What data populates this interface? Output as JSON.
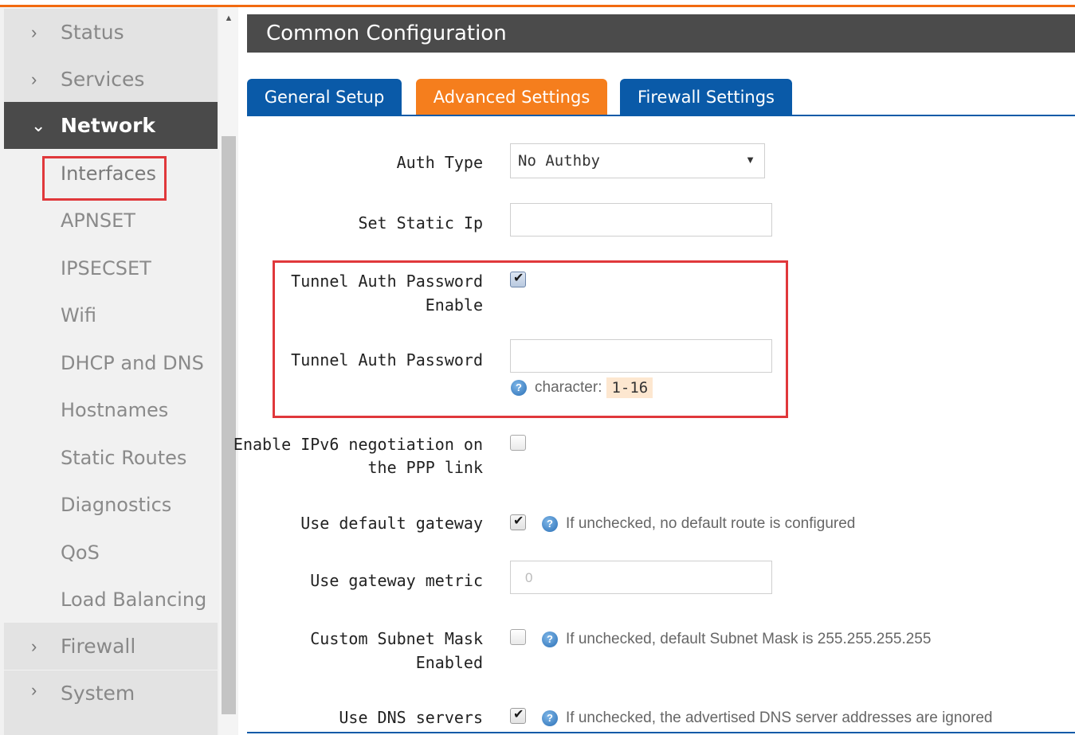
{
  "sidebar": {
    "groups_top": [
      {
        "label": "Status",
        "icon": "chevron-right-icon"
      },
      {
        "label": "Services",
        "icon": "chevron-right-icon"
      }
    ],
    "active_group": {
      "label": "Network",
      "icon": "chevron-down-icon"
    },
    "network_items": [
      "Interfaces",
      "APNSET",
      "IPSECSET",
      "Wifi",
      "DHCP and DNS",
      "Hostnames",
      "Static Routes",
      "Diagnostics",
      "QoS",
      "Load Balancing"
    ],
    "groups_bottom": [
      {
        "label": "Firewall",
        "icon": "chevron-right-icon"
      },
      {
        "label": "System",
        "icon": "chevron-right-icon"
      }
    ]
  },
  "header": {
    "title": "Common Configuration"
  },
  "tabs": [
    {
      "label": "General Setup",
      "active": false
    },
    {
      "label": "Advanced Settings",
      "active": true
    },
    {
      "label": "Firewall Settings",
      "active": false
    }
  ],
  "form": {
    "auth_type": {
      "label": "Auth Type",
      "value": "No Authby"
    },
    "static_ip": {
      "label": "Set Static Ip",
      "value": ""
    },
    "tunnel_pw_enable": {
      "label_line1": "Tunnel Auth Password",
      "label_line2": "Enable",
      "checked": true
    },
    "tunnel_pw": {
      "label": "Tunnel Auth Password",
      "value": "",
      "hint": "character:",
      "hint_range": "1-16"
    },
    "ipv6": {
      "label_line1": "Enable IPv6 negotiation on",
      "label_line2": "the PPP link",
      "checked": false
    },
    "default_gw": {
      "label": "Use default gateway",
      "checked": true,
      "hint": "If unchecked, no default route is configured"
    },
    "gw_metric": {
      "label": "Use gateway metric",
      "placeholder": "0"
    },
    "subnet_mask": {
      "label_line1": "Custom Subnet Mask",
      "label_line2": "Enabled",
      "checked": false,
      "hint": "If unchecked, default Subnet Mask is 255.255.255.255"
    },
    "dns": {
      "label": "Use DNS servers",
      "checked": true,
      "hint": "If unchecked, the advertised DNS server addresses are ignored"
    }
  },
  "colors": {
    "accent_orange": "#f57e1d",
    "tab_blue": "#0a5aa8",
    "highlight_red": "#e0383b",
    "header_dark": "#4b4b4b"
  }
}
